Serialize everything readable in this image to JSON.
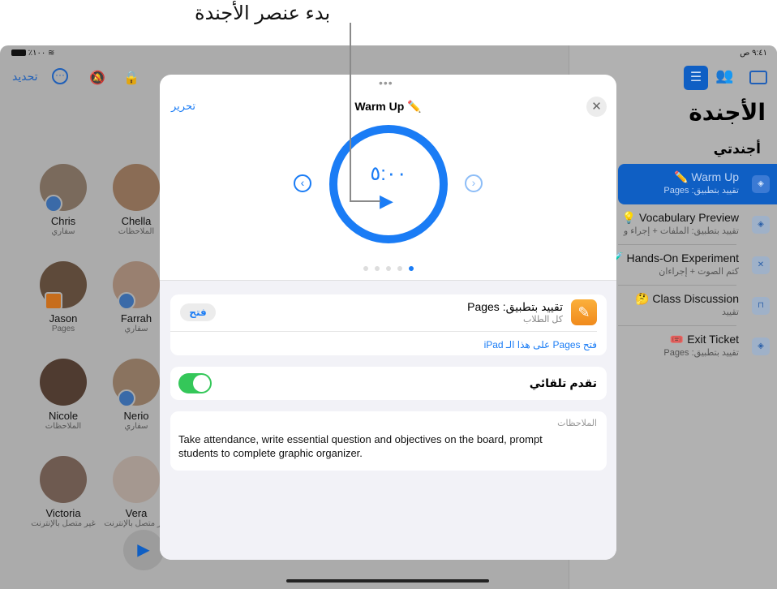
{
  "callout": "بدء عنصر الأجندة",
  "status": {
    "battery": "٪١٠٠",
    "time": "٩:٤١ ص"
  },
  "toolbar": {
    "refresh": "تحديد"
  },
  "sidebar": {
    "title": "الأجندة",
    "section": "أجندتي",
    "items": [
      {
        "title": "Warm Up ✏️",
        "subtitle": "تقييد بتطبيق: Pages",
        "icon": "layers-icon"
      },
      {
        "title": "Vocabulary Preview 💡",
        "subtitle": "تقييد بتطبيق: الملفات + إجراء و",
        "icon": "layers-icon"
      },
      {
        "title": "Hands-On Experiment 🧪",
        "subtitle": "كتم الصوت + إجراءان",
        "icon": "mute-icon"
      },
      {
        "title": "Class Discussion 🤔",
        "subtitle": "تقييد",
        "icon": "lock-icon"
      },
      {
        "title": "Exit Ticket 🎟️",
        "subtitle": "تقييد بتطبيق: Pages",
        "icon": "layers-icon"
      }
    ]
  },
  "students": [
    {
      "name": "Chris",
      "app": "سفاري"
    },
    {
      "name": "Chella",
      "app": "الملاحظات"
    },
    {
      "name": "Jason",
      "app": "Pages"
    },
    {
      "name": "Farrah",
      "app": "سفاري"
    },
    {
      "name": "Nicole",
      "app": "الملاحظات"
    },
    {
      "name": "Nerio",
      "app": "سفاري"
    },
    {
      "name": "Victoria",
      "app": "غير متصل بالإنترنت"
    },
    {
      "name": "Vera",
      "app": "غير متصل بالإنترنت"
    }
  ],
  "modal": {
    "edit": "تحرير",
    "title": "Warm Up ✏️",
    "timer": "٥:٠٠",
    "page_count": 5,
    "current_page": 5,
    "restriction_title": "تقييد بتطبيق: Pages",
    "restriction_sub": "كل الطلاب",
    "open_button": "فتح",
    "open_link": "فتح Pages على هذا الـ iPad",
    "auto_advance": "تقدم تلقائي",
    "auto_advance_on": true,
    "notes_label": "الملاحظات",
    "notes": "Take attendance, write essential question and objectives on the board, prompt students to complete graphic organizer."
  },
  "colors": {
    "accent": "#1a7cf5",
    "toggle": "#34c759",
    "pages": "#f7a334"
  }
}
